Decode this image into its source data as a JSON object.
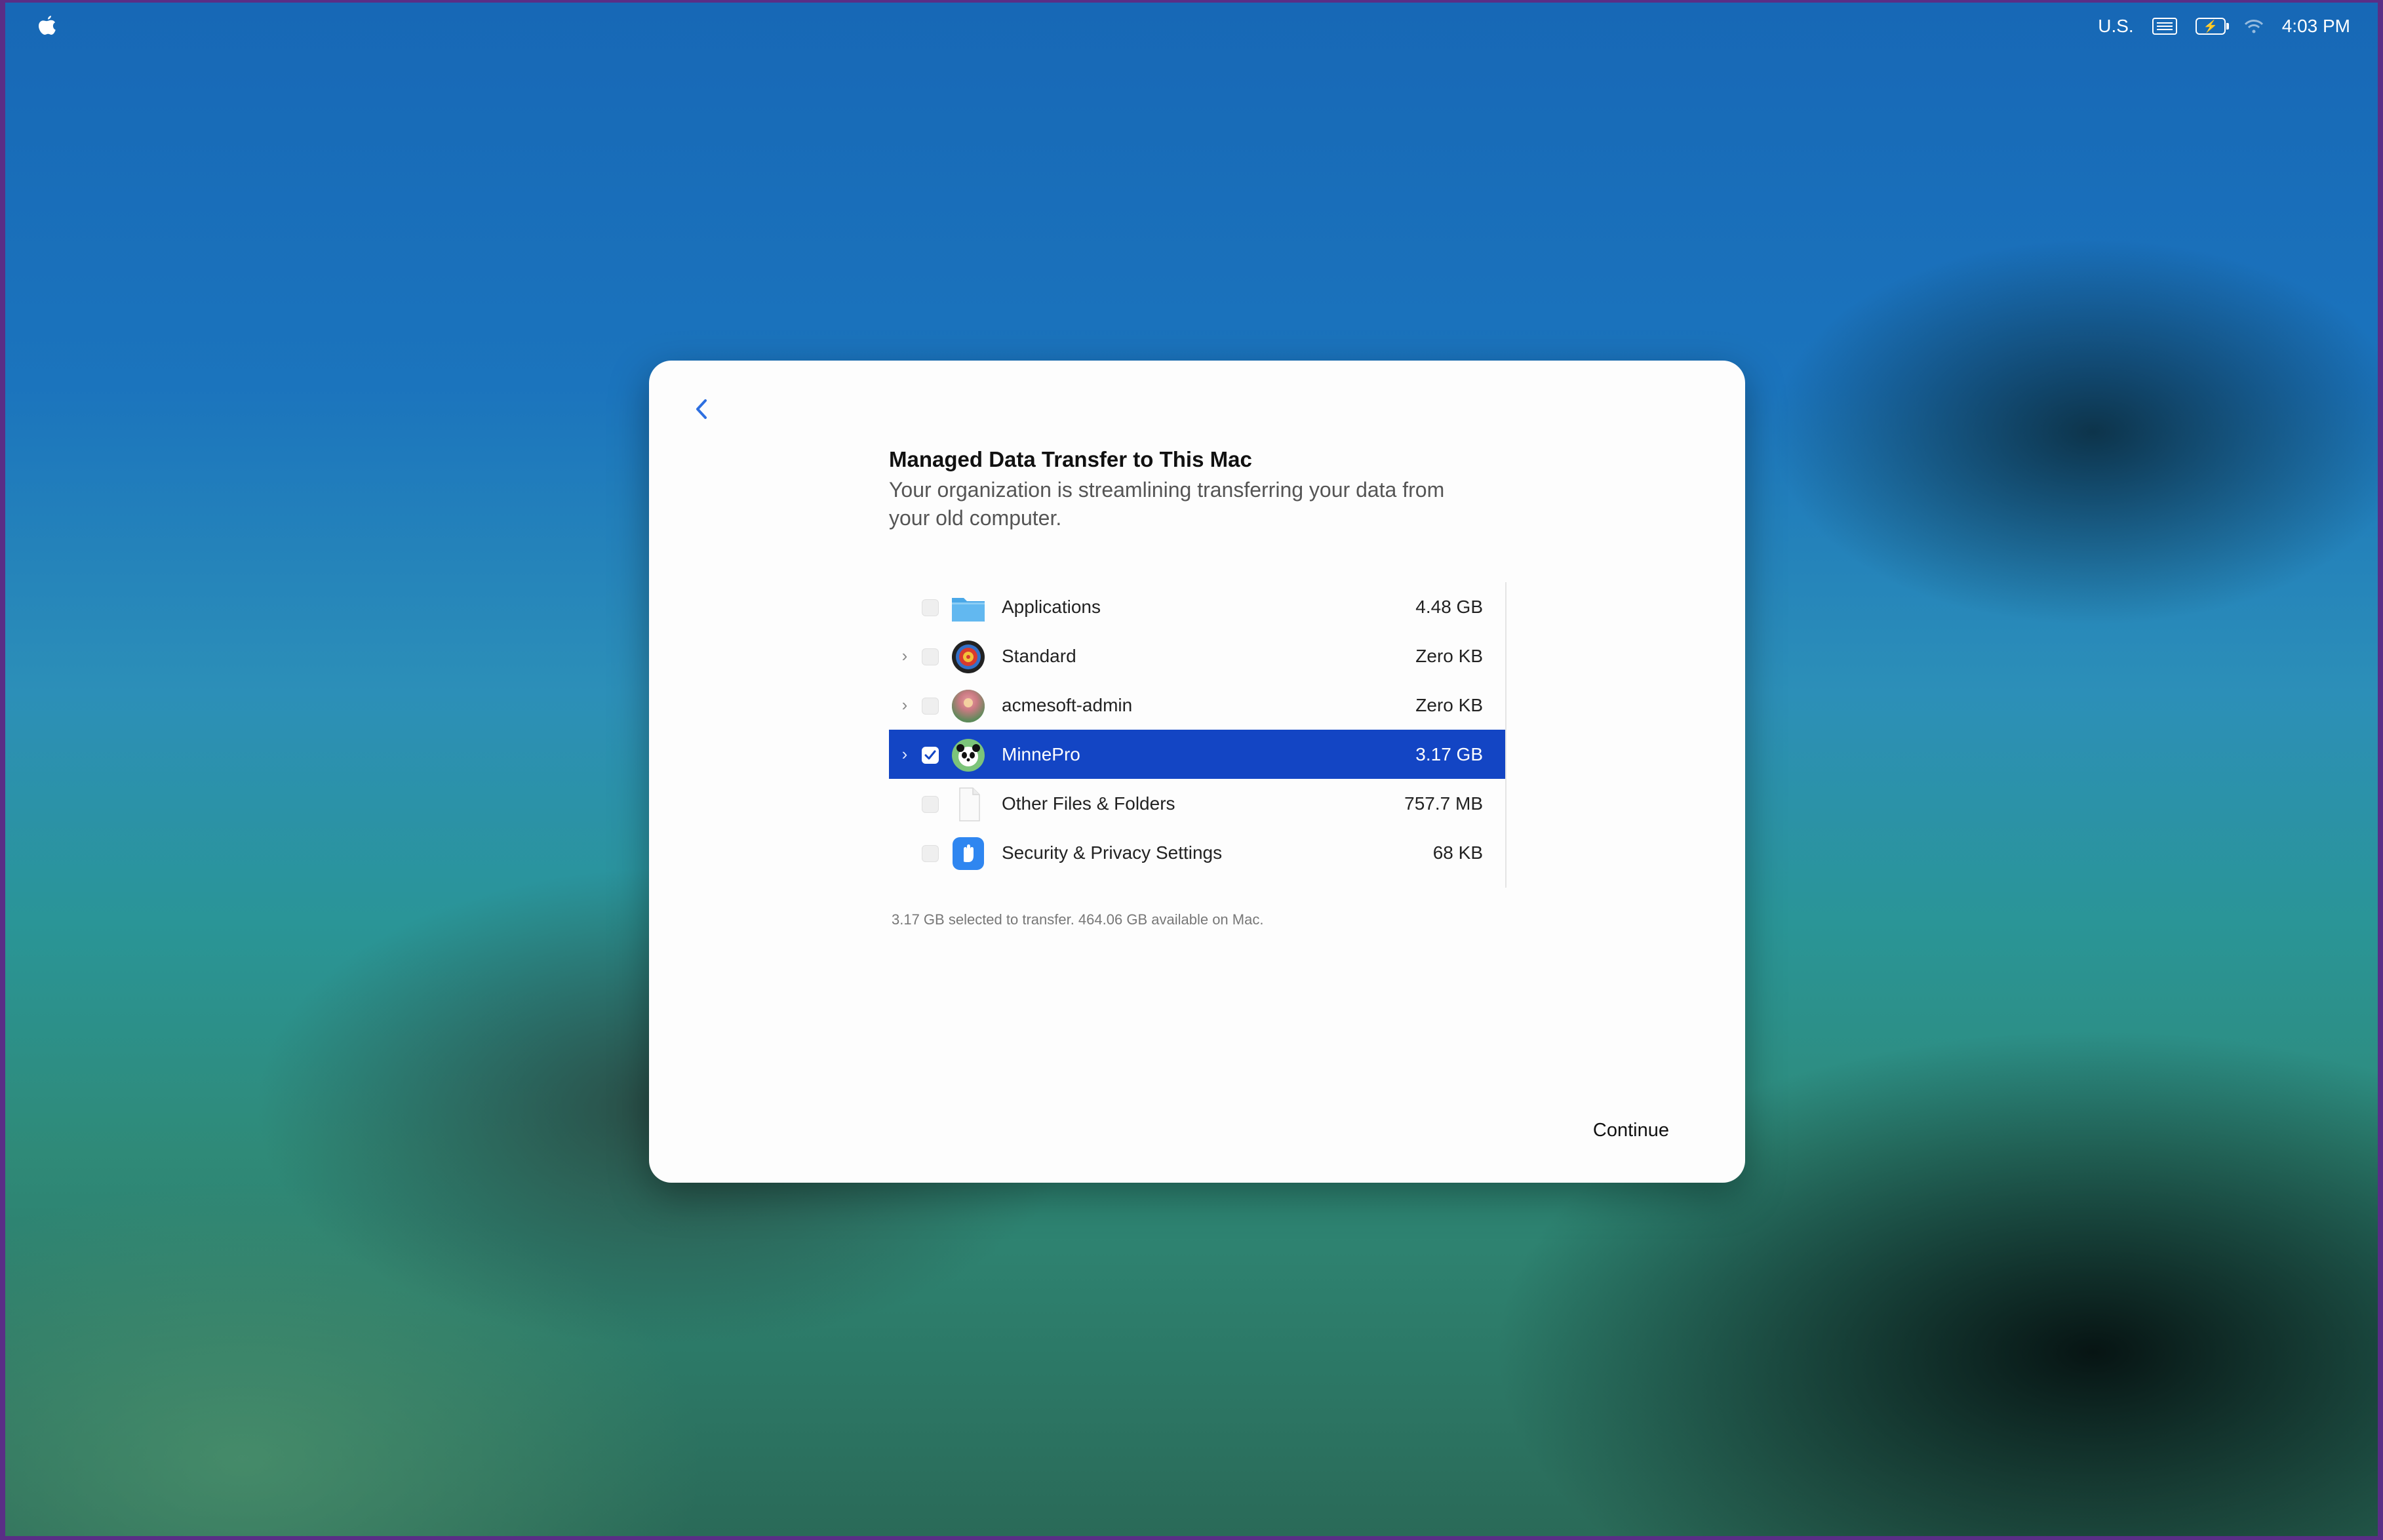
{
  "menubar": {
    "input_source": "U.S.",
    "clock": "4:03 PM"
  },
  "dialog": {
    "title": "Managed Data Transfer to This Mac",
    "subtitle": "Your organization is streamlining transferring your data from your old computer.",
    "items": [
      {
        "label": "Applications",
        "size": "4.48 GB",
        "icon": "folder-icon",
        "expandable": false,
        "checked": false,
        "selected": false
      },
      {
        "label": "Standard",
        "size": "Zero KB",
        "icon": "target-avatar-icon",
        "expandable": true,
        "checked": false,
        "selected": false
      },
      {
        "label": "acmesoft-admin",
        "size": "Zero KB",
        "icon": "flower-avatar-icon",
        "expandable": true,
        "checked": false,
        "selected": false
      },
      {
        "label": "MinnePro",
        "size": "3.17 GB",
        "icon": "panda-avatar-icon",
        "expandable": true,
        "checked": true,
        "selected": true
      },
      {
        "label": "Other Files & Folders",
        "size": "757.7 MB",
        "icon": "document-icon",
        "expandable": false,
        "checked": false,
        "selected": false
      },
      {
        "label": "Security & Privacy Settings",
        "size": "68 KB",
        "icon": "hand-shield-icon",
        "expandable": false,
        "checked": false,
        "selected": false
      }
    ],
    "footnote": "3.17 GB selected to transfer. 464.06 GB available on Mac.",
    "continue_label": "Continue"
  },
  "colors": {
    "selection": "#1345c4",
    "dialog_bg": "#fdfdfd"
  }
}
